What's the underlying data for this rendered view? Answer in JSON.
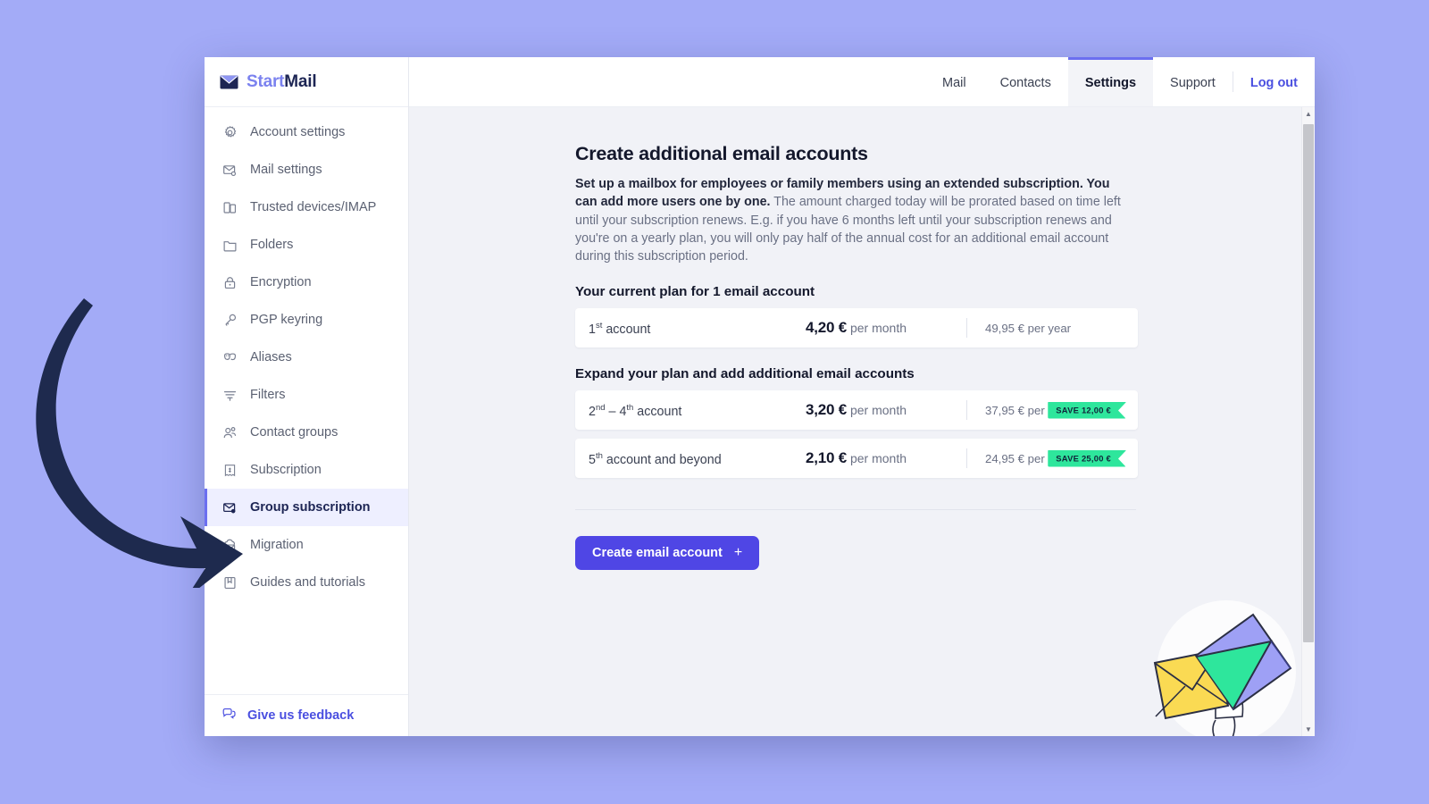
{
  "page": {
    "background_color": "#a3abf7",
    "accent_color": "#4f46e5",
    "badge_color": "#2ee69c"
  },
  "brand": {
    "name_part1": "Start",
    "name_part2": "Mail",
    "logo_icon": "envelope-icon"
  },
  "topnav": {
    "items": [
      {
        "label": "Mail",
        "active": false
      },
      {
        "label": "Contacts",
        "active": false
      },
      {
        "label": "Settings",
        "active": true
      },
      {
        "label": "Support",
        "active": false
      },
      {
        "label": "Log out",
        "active": false
      }
    ]
  },
  "sidebar": {
    "items": [
      {
        "label": "Account settings",
        "icon": "gear-icon",
        "active": false
      },
      {
        "label": "Mail settings",
        "icon": "envelope-gear-icon",
        "active": false
      },
      {
        "label": "Trusted devices/IMAP",
        "icon": "devices-icon",
        "active": false
      },
      {
        "label": "Folders",
        "icon": "folder-icon",
        "active": false
      },
      {
        "label": "Encryption",
        "icon": "lock-icon",
        "active": false
      },
      {
        "label": "PGP keyring",
        "icon": "key-icon",
        "active": false
      },
      {
        "label": "Aliases",
        "icon": "masks-icon",
        "active": false
      },
      {
        "label": "Filters",
        "icon": "filter-icon",
        "active": false
      },
      {
        "label": "Contact groups",
        "icon": "people-icon",
        "active": false
      },
      {
        "label": "Subscription",
        "icon": "receipt-icon",
        "active": false
      },
      {
        "label": "Group subscription",
        "icon": "envelope-user-icon",
        "active": true
      },
      {
        "label": "Migration",
        "icon": "cloud-mail-icon",
        "active": false
      },
      {
        "label": "Guides and tutorials",
        "icon": "book-icon",
        "active": false
      }
    ],
    "footer": {
      "label": "Give us feedback",
      "icon": "chat-bubbles-icon"
    }
  },
  "main": {
    "title": "Create additional email accounts",
    "intro_bold": "Set up a mailbox for employees or family members using an extended subscription. You can add more users one by one.",
    "intro_rest": " The amount charged today will be prorated based on time left until your subscription renews. E.g. if you have 6 months left until your subscription renews and you're on a yearly plan, you will only pay half of the annual cost for an additional email account during this subscription period.",
    "current_plan_heading": "Your current plan for 1 email account",
    "current_plan_row": {
      "tier_number": "1",
      "tier_ordinal": "st",
      "tier_suffix": " account",
      "monthly_price": "4,20 €",
      "monthly_unit": "per month",
      "yearly": "49,95 € per year",
      "badge": ""
    },
    "expand_heading": "Expand your plan and add additional email accounts",
    "expand_rows": [
      {
        "tier_number": "2",
        "tier_ordinal": "nd",
        "tier_number2": "4",
        "tier_ordinal2": "th",
        "tier_suffix": " account",
        "monthly_price": "3,20 €",
        "monthly_unit": "per month",
        "yearly": "37,95 € per year",
        "badge": "SAVE 12,00 €"
      },
      {
        "tier_number": "5",
        "tier_ordinal": "th",
        "tier_suffix": " account and beyond",
        "monthly_price": "2,10 €",
        "monthly_unit": "per month",
        "yearly": "24,95 € per year",
        "badge": "SAVE 25,00 €"
      }
    ],
    "cta_label": "Create email account",
    "cta_icon": "plus-icon"
  },
  "scrollbar": {
    "up_icon": "chevron-up-icon",
    "down_icon": "chevron-down-icon"
  }
}
